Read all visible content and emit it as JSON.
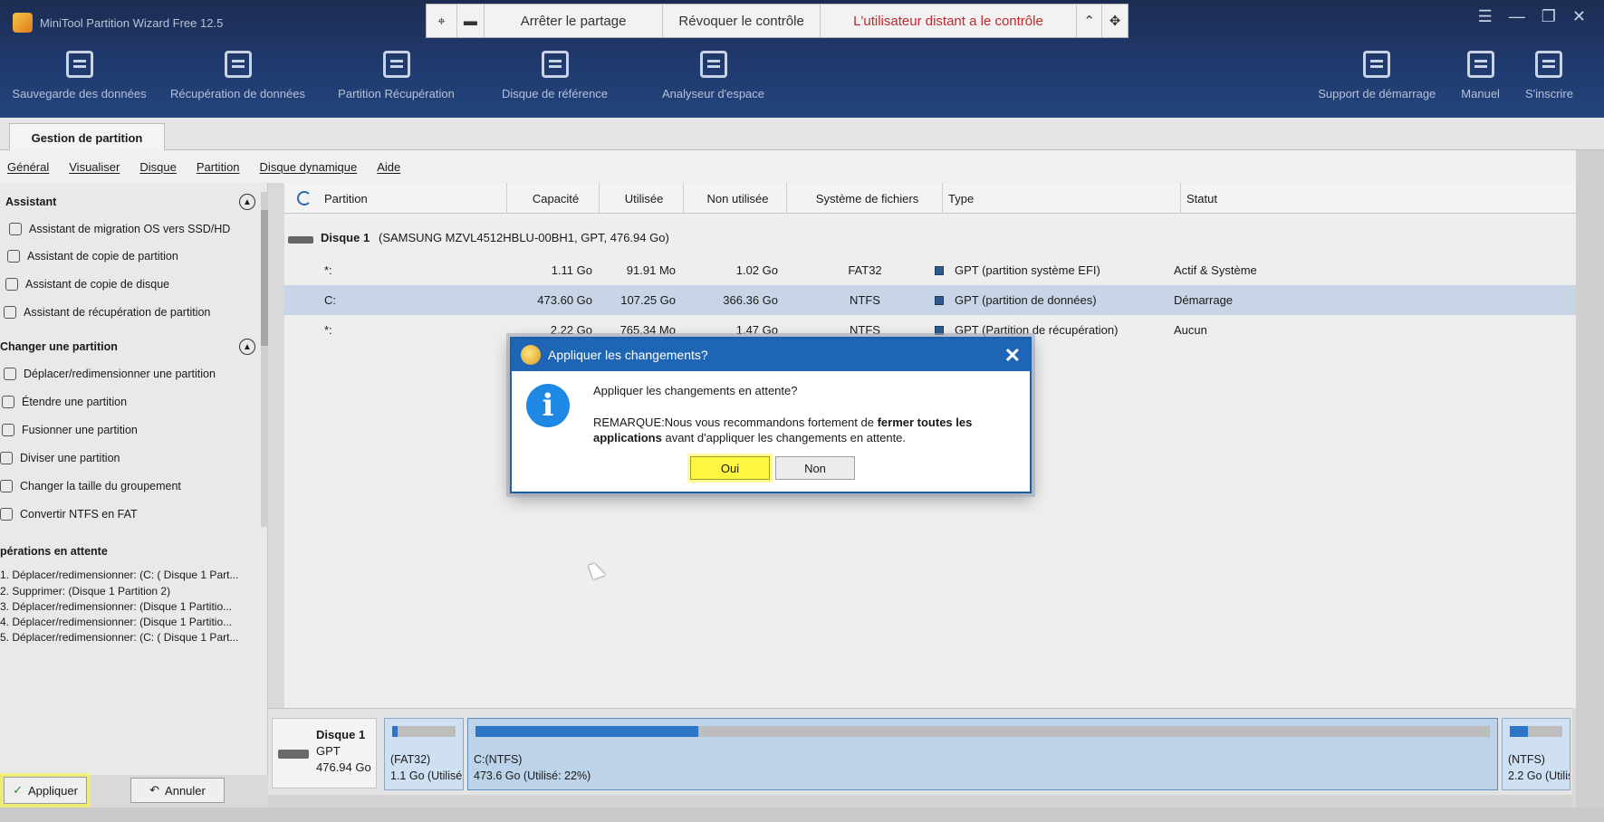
{
  "app": {
    "title": "MiniTool Partition Wizard Free 12.5",
    "window_controls": [
      "☰",
      "—",
      "❐",
      "✕"
    ]
  },
  "share_bar": {
    "stop_sharing": "Arrêter le partage",
    "revoke_control": "Révoquer le contrôle",
    "remote_status": "L'utilisateur distant a le contrôle"
  },
  "toolbar": {
    "items": [
      {
        "label": "Sauvegarde des données",
        "icon": "backup-icon"
      },
      {
        "label": "Récupération de données",
        "icon": "data-recovery-icon"
      },
      {
        "label": "Partition Récupération",
        "icon": "partition-recovery-icon"
      },
      {
        "label": "Disque de référence",
        "icon": "disk-benchmark-icon"
      },
      {
        "label": "Analyseur d'espace",
        "icon": "space-analyzer-icon"
      }
    ],
    "right_items": [
      {
        "label": "Support de démarrage",
        "icon": "bootable-media-icon"
      },
      {
        "label": "Manuel",
        "icon": "manual-icon"
      },
      {
        "label": "S'inscrire",
        "icon": "register-icon"
      }
    ]
  },
  "tab": {
    "label": "Gestion de partition"
  },
  "menu": [
    "Général",
    "Visualiser",
    "Disque",
    "Partition",
    "Disque dynamique",
    "Aide"
  ],
  "left_panel": {
    "assistant_title": "Assistant",
    "assistant_items": [
      "Assistant de migration OS vers SSD/HD",
      "Assistant de copie de partition",
      "Assistant de copie de disque",
      "Assistant de récupération de partition"
    ],
    "change_title": "Changer une partition",
    "change_items": [
      "Déplacer/redimensionner une partition",
      "Étendre une partition",
      "Fusionner une partition",
      "Diviser une partition",
      "Changer la taille du groupement",
      "Convertir NTFS en FAT"
    ],
    "pending_title": "pérations en attente",
    "pending_items": [
      "1. Déplacer/redimensionner: (C: ( Disque 1 Part...",
      "2. Supprimer: (Disque 1 Partition 2)",
      "3. Déplacer/redimensionner: (Disque 1 Partitio...",
      "4. Déplacer/redimensionner: (Disque 1 Partitio...",
      "5. Déplacer/redimensionner: (C: ( Disque 1 Part..."
    ],
    "apply_label": "Appliquer",
    "cancel_label": "Annuler"
  },
  "table": {
    "columns": [
      "Partition",
      "Capacité",
      "Utilisée",
      "Non utilisée",
      "Système de fichiers",
      "Type",
      "Statut"
    ],
    "disk": {
      "name": "Disque 1",
      "info": "(SAMSUNG MZVL4512HBLU-00BH1, GPT, 476.94 Go)"
    },
    "rows": [
      {
        "partition": "*:",
        "capacity": "1.11 Go",
        "used": "91.91 Mo",
        "unused": "1.02 Go",
        "fs": "FAT32",
        "type": "GPT (partition système EFI)",
        "status": "Actif & Système"
      },
      {
        "partition": "C:",
        "capacity": "473.60 Go",
        "used": "107.25 Go",
        "unused": "366.36 Go",
        "fs": "NTFS",
        "type": "GPT (partition de données)",
        "status": "Démarrage"
      },
      {
        "partition": "*:",
        "capacity": "2.22 Go",
        "used": "765.34 Mo",
        "unused": "1.47 Go",
        "fs": "NTFS",
        "type": "GPT (Partition de récupération)",
        "status": "Aucun"
      }
    ]
  },
  "disk_map": {
    "disk_name": "Disque 1",
    "disk_type": "GPT",
    "disk_size": "476.94 Go",
    "partitions": [
      {
        "label": "(FAT32)",
        "detail": "1.1 Go (Utilisé",
        "used_fraction": 0.08
      },
      {
        "label": "C:(NTFS)",
        "detail": "473.6 Go (Utilisé: 22%)",
        "used_fraction": 0.22
      },
      {
        "label": "(NTFS)",
        "detail": "2.2 Go (Utilis",
        "used_fraction": 0.35
      }
    ]
  },
  "modal": {
    "title": "Appliquer les changements?",
    "question": "Appliquer les changements en attente?",
    "note_prefix": "REMARQUE:Nous vous recommandons fortement de ",
    "note_bold1": "fermer toutes les applications",
    "note_suffix": " avant d'appliquer les changements en attente.",
    "yes_label": "Oui",
    "no_label": "Non",
    "close_symbol": "✕"
  },
  "colors": {
    "header": "#203a6e",
    "accent_blue": "#1e66b5",
    "selected_row": "#c8d5e6",
    "highlight_yellow": "#fff640",
    "alert_red": "#c0282d"
  }
}
